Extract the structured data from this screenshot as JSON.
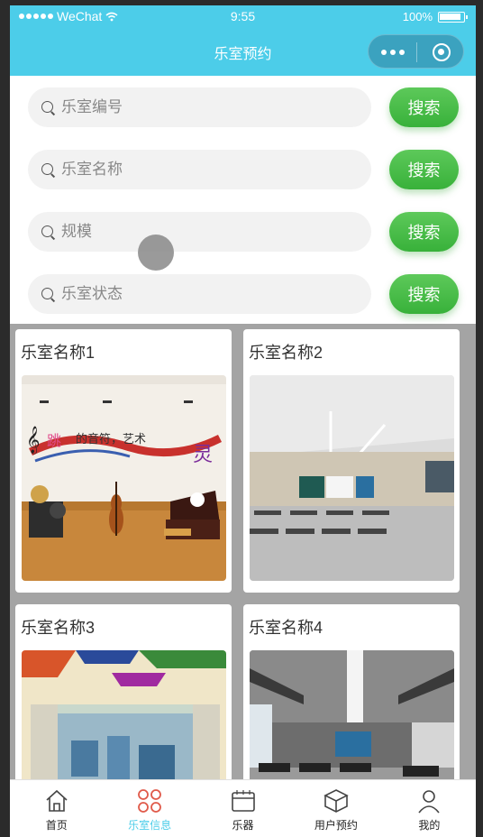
{
  "status_bar": {
    "carrier": "WeChat",
    "time": "9:55",
    "battery": "100%"
  },
  "nav": {
    "title": "乐室预约"
  },
  "search": [
    {
      "placeholder": "乐室编号",
      "button": "搜索"
    },
    {
      "placeholder": "乐室名称",
      "button": "搜索"
    },
    {
      "placeholder": "规模",
      "button": "搜索"
    },
    {
      "placeholder": "乐室状态",
      "button": "搜索"
    }
  ],
  "rooms": [
    {
      "name": "乐室名称1"
    },
    {
      "name": "乐室名称2"
    },
    {
      "name": "乐室名称3"
    },
    {
      "name": "乐室名称4"
    }
  ],
  "tabbar": [
    {
      "label": "首页",
      "icon": "home-icon",
      "active": false
    },
    {
      "label": "乐室信息",
      "icon": "clover-icon",
      "active": true
    },
    {
      "label": "乐器",
      "icon": "instrument-icon",
      "active": false
    },
    {
      "label": "用户预约",
      "icon": "box-icon",
      "active": false
    },
    {
      "label": "我的",
      "icon": "user-icon",
      "active": false
    }
  ],
  "colors": {
    "theme": "#4ccde9",
    "button": "#3fb542",
    "active_tab": "#4ccde9",
    "active_icon": "#e05a4a"
  }
}
